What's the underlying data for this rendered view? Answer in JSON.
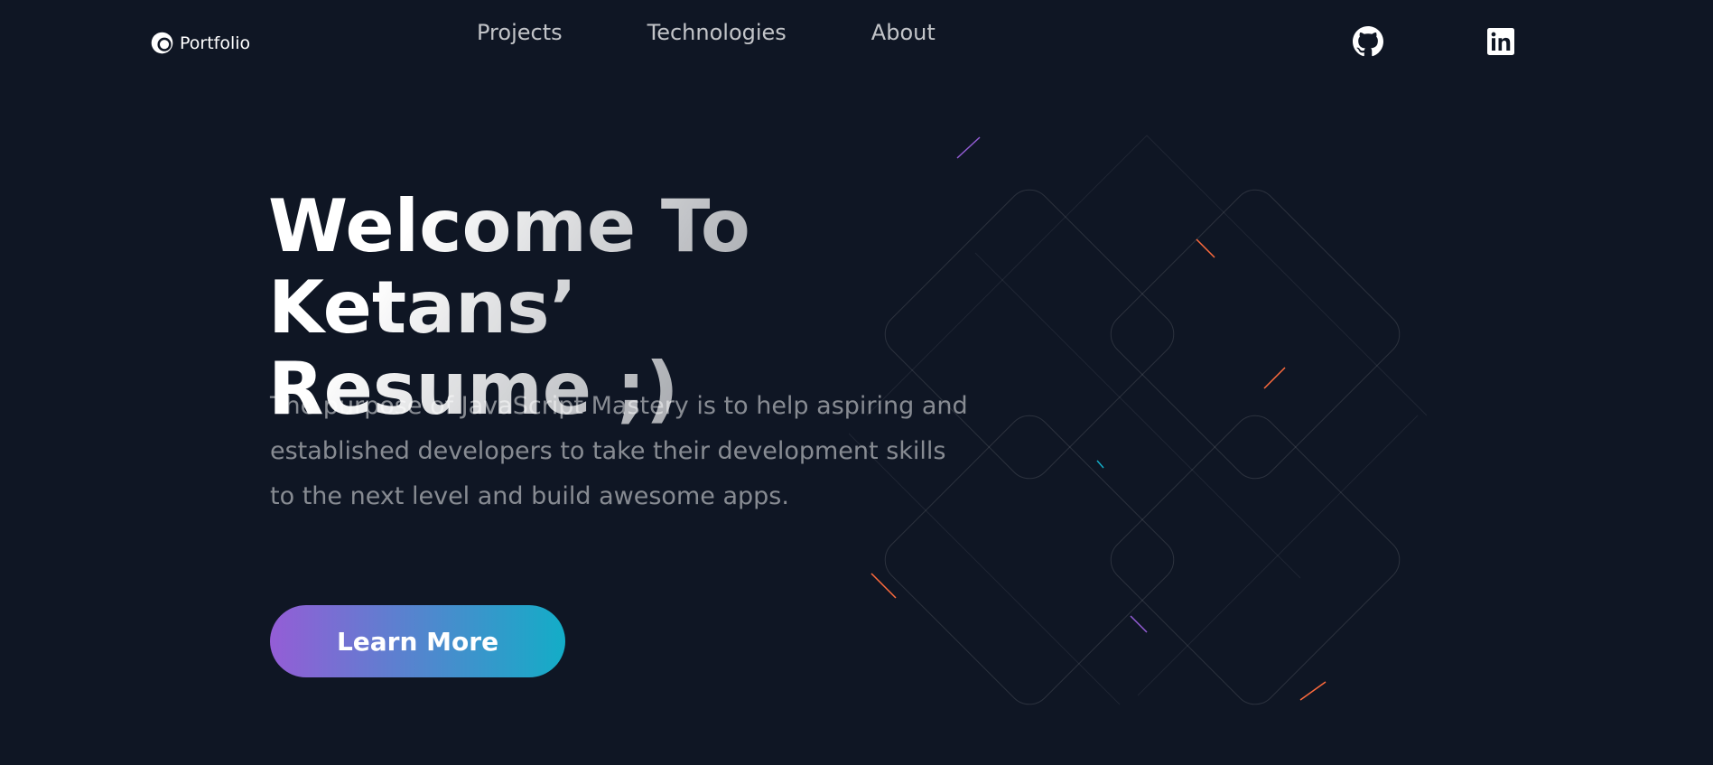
{
  "header": {
    "logo_text": "Portfolio",
    "nav": [
      {
        "label": "Projects"
      },
      {
        "label": "Technologies"
      },
      {
        "label": "About"
      }
    ],
    "social": [
      {
        "icon": "github-icon"
      },
      {
        "icon": "linkedin-icon"
      }
    ]
  },
  "hero": {
    "title_line1": "Welcome To Ketans’",
    "title_line2": "Resume ;)",
    "description": "The purpose of JavaScript Mastery is to help aspiring and established developers to take their development skills to the next level and build awesome apps.",
    "cta_label": "Learn More"
  },
  "colors": {
    "background": "#0f1624",
    "cta_gradient_start": "#945dd6",
    "cta_gradient_mid": "#6978d1",
    "cta_gradient_end": "#13adc7"
  }
}
